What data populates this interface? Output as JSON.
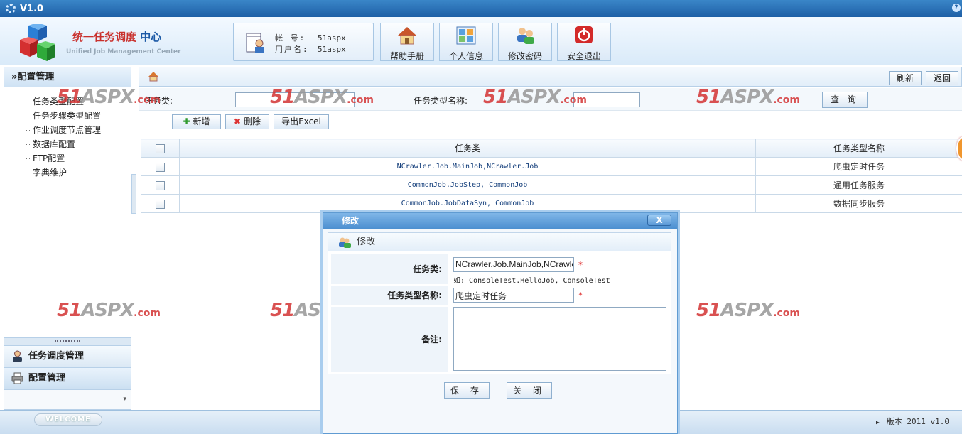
{
  "titlebar": {
    "version": "V1.0"
  },
  "header": {
    "title_red": "统一任务调度",
    "title_blue": " 中心",
    "subtitle": "Unified Job Management Center",
    "account": {
      "label_account": "帐 号:",
      "account": "51aspx",
      "label_user": "用户名:",
      "user": "51aspx"
    },
    "buttons": [
      {
        "label": "帮助手册",
        "icon": "house-icon"
      },
      {
        "label": "个人信息",
        "icon": "profile-grid-icon"
      },
      {
        "label": "修改密码",
        "icon": "users-icon"
      },
      {
        "label": "安全退出",
        "icon": "power-icon"
      }
    ]
  },
  "sidebar": {
    "header": "»配置管理",
    "tree": [
      "任务类型配置",
      "任务步骤类型配置",
      "作业调度节点管理",
      "数据库配置",
      "FTP配置",
      "字典维护"
    ],
    "tabs": [
      "任务调度管理",
      "配置管理"
    ]
  },
  "crumb": {
    "refresh": "刷新",
    "back": "返回"
  },
  "search": {
    "label_class": "任务类:",
    "label_name": "任务类型名称:",
    "query": "查 询"
  },
  "toolbar": {
    "add": "新增",
    "delete": "删除",
    "export": "导出Excel"
  },
  "table": {
    "headers": [
      "任务类",
      "任务类型名称"
    ],
    "rows": [
      {
        "cls": "NCrawler.Job.MainJob,NCrawler.Job",
        "name": "爬虫定时任务"
      },
      {
        "cls": "CommonJob.JobStep, CommonJob",
        "name": "通用任务服务"
      },
      {
        "cls": "CommonJob.JobDataSyn, CommonJob",
        "name": "数据同步服务"
      }
    ]
  },
  "modal": {
    "title": "修改",
    "close": "X",
    "subtitle": "修改",
    "label_class": "任务类:",
    "value_class": "NCrawler.Job.MainJob,NCrawler.Job",
    "hint": "如: ConsoleTest.HelloJob, ConsoleTest",
    "label_name": "任务类型名称:",
    "value_name": "爬虫定时任务",
    "label_note": "备注:",
    "required": "*",
    "save": "保 存",
    "close_btn": "关 闭"
  },
  "watermark": {
    "main": "51",
    "aspx": "ASPX",
    "suffix": ".com"
  },
  "footer": {
    "welcome": "WELCOME",
    "version": "版本 2011 v1.0"
  },
  "colors": {
    "accent": "#1e5fa6",
    "brand_red": "#c9302c",
    "border": "#b7d0e8"
  }
}
